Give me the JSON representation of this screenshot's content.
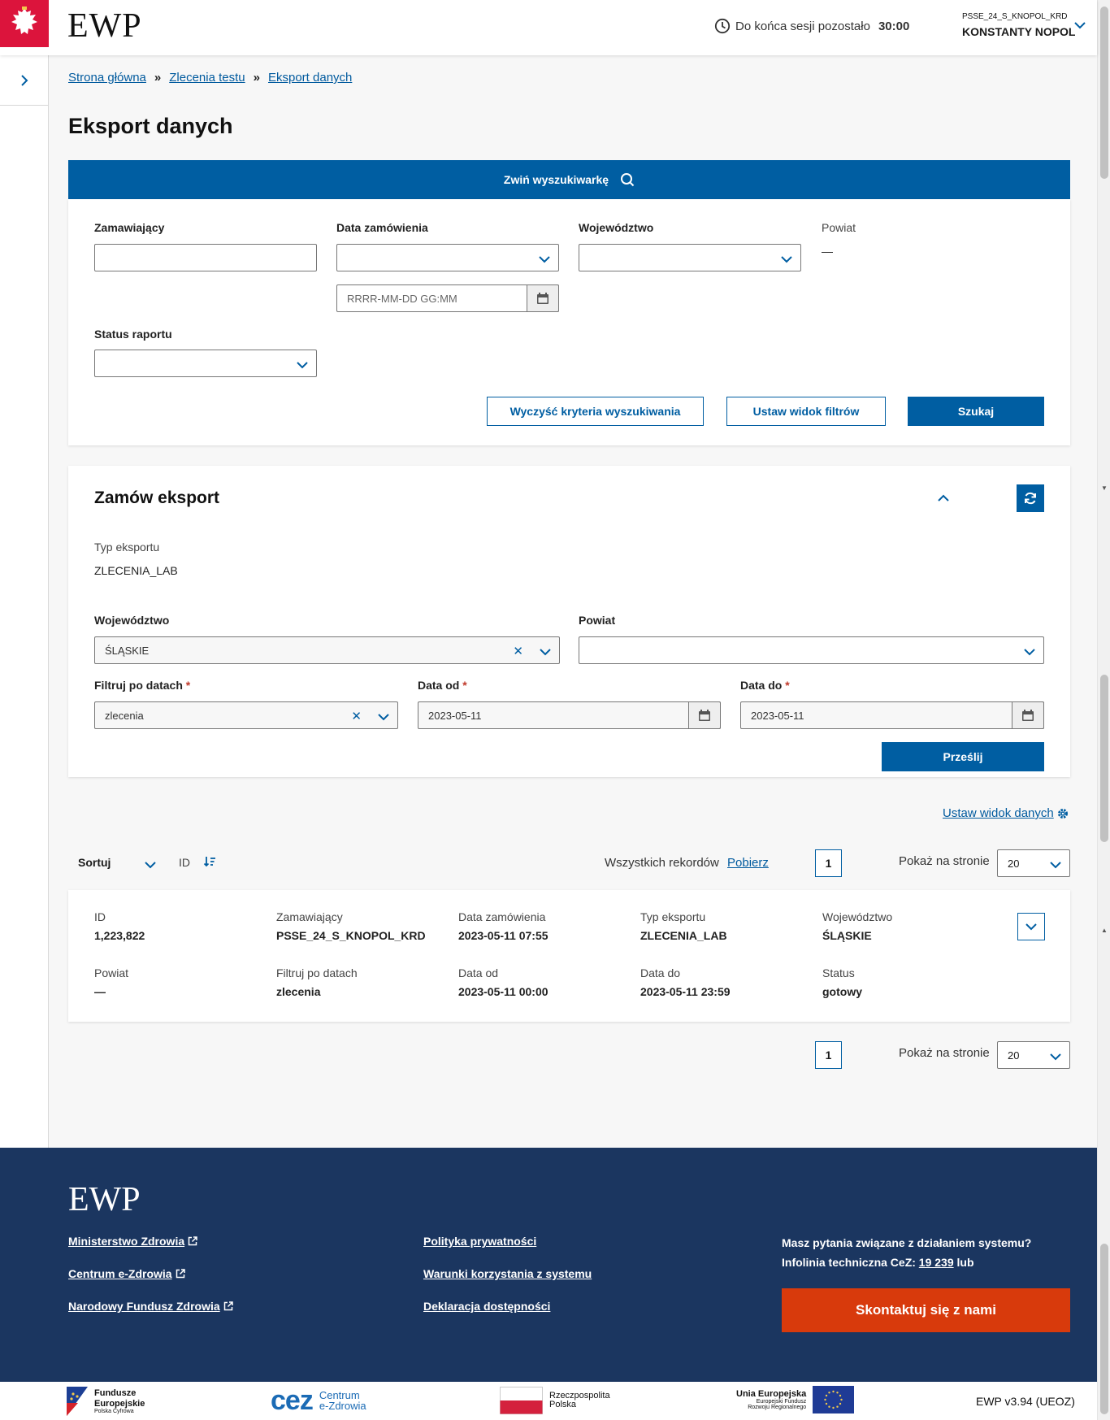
{
  "header": {
    "logo": "EWP",
    "session_label": "Do końca sesji pozostało",
    "session_time": "30:00",
    "user_org": "PSSE_24_S_KNOPOL_KRD",
    "user_name": "KONSTANTY NOPOL"
  },
  "breadcrumb": [
    "Strona główna",
    "Zlecenia testu",
    "Eksport danych"
  ],
  "page_title": "Eksport danych",
  "search": {
    "toggle_label": "Zwiń wyszukiwarkę",
    "fields": {
      "zamawiajacy": {
        "label": "Zamawiający",
        "value": ""
      },
      "data_zamowienia": {
        "label": "Data zamówienia",
        "value": "",
        "date_placeholder": "RRRR-MM-DD GG:MM"
      },
      "wojewodztwo": {
        "label": "Województwo",
        "value": ""
      },
      "powiat": {
        "label": "Powiat",
        "value": "—"
      },
      "status_raportu": {
        "label": "Status raportu",
        "value": ""
      }
    },
    "buttons": {
      "clear": "Wyczyść kryteria wyszukiwania",
      "filter_view": "Ustaw widok filtrów",
      "search": "Szukaj"
    }
  },
  "export": {
    "title": "Zamów eksport",
    "type_label": "Typ eksportu",
    "type_value": "ZLECENIA_LAB",
    "wojewodztwo_label": "Województwo",
    "wojewodztwo_value": "ŚLĄSKIE",
    "powiat_label": "Powiat",
    "powiat_value": "",
    "filter_label": "Filtruj po datach",
    "filter_value": "zlecenia",
    "date_from_label": "Data od",
    "date_from_value": "2023-05-11",
    "date_to_label": "Data do",
    "date_to_value": "2023-05-11",
    "required_mark": "*",
    "submit": "Prześlij"
  },
  "results": {
    "set_view": "Ustaw widok danych",
    "sort_label": "Sortuj",
    "sort_field": "ID",
    "total_label": "Wszystkich rekordów",
    "download": "Pobierz",
    "page": "1",
    "per_page_label": "Pokaż na stronie",
    "per_page": "20",
    "records": [
      {
        "id_label": "ID",
        "id": "1,223,822",
        "zam_label": "Zamawiający",
        "zam": "PSSE_24_S_KNOPOL_KRD",
        "date_label": "Data zamówienia",
        "date": "2023-05-11 07:55",
        "type_label": "Typ eksportu",
        "type": "ZLECENIA_LAB",
        "woj_label": "Województwo",
        "woj": "ŚLĄSKIE",
        "powiat_label": "Powiat",
        "powiat": "—",
        "filter_label": "Filtruj po datach",
        "filter": "zlecenia",
        "from_label": "Data od",
        "from": "2023-05-11 00:00",
        "to_label": "Data do",
        "to": "2023-05-11 23:59",
        "status_label": "Status",
        "status": "gotowy"
      }
    ]
  },
  "footer": {
    "logo": "EWP",
    "links_col1": [
      "Ministerstwo Zdrowia",
      "Centrum e-Zdrowia",
      "Narodowy Fundusz Zdrowia"
    ],
    "links_col2": [
      "Polityka prywatności",
      "Warunki korzystania z systemu",
      "Deklaracja dostępności"
    ],
    "question": "Masz pytania związane z działaniem systemu?",
    "hotline_prefix": "Infolinia techniczna CeZ:",
    "hotline_number": "19 239",
    "hotline_suffix": "lub",
    "contact": "Skontaktuj się z nami"
  },
  "partners": {
    "fe_title1": "Fundusze",
    "fe_title2": "Europejskie",
    "fe_sub": "Polska Cyfrowa",
    "cez_mark": "cez",
    "cez_line1": "Centrum",
    "cez_line2": "e-Zdrowia",
    "rp_line1": "Rzeczpospolita",
    "rp_line2": "Polska",
    "ue_title": "Unia Europejska",
    "ue_sub1": "Europejski Fundusz",
    "ue_sub2": "Rozwoju Regionalnego",
    "version": "EWP v3.94 (UEOZ)"
  },
  "colors": {
    "primary": "#005ea2",
    "footer": "#1b3660",
    "contact": "#d83a0c",
    "emblem": "#dc143c"
  },
  "icons": [
    "clock-icon",
    "chevron-down-icon",
    "chevron-right-icon",
    "search-icon",
    "calendar-icon",
    "refresh-icon",
    "chevron-up-icon",
    "gear-icon",
    "sort-icon",
    "external-link-icon",
    "close-icon"
  ]
}
